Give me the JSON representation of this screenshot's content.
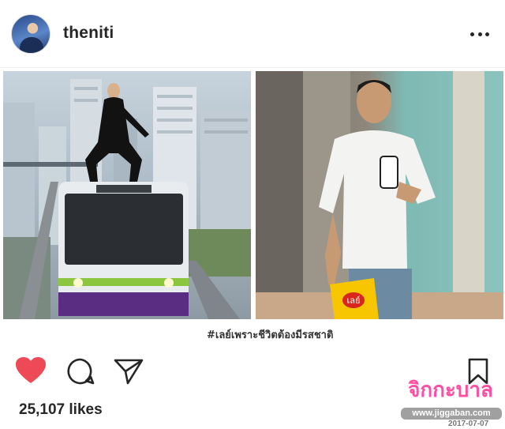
{
  "header": {
    "username": "theniti",
    "more_icon": "more-horizontal-icon"
  },
  "post": {
    "hashtag": "#เลย์เพราะชีวิตต้องมีรสชาติ",
    "left_photo": "woman-on-skytrain-photo",
    "right_photo": "man-with-chips-photo",
    "chips_brand": "เลย์"
  },
  "actions": {
    "like_icon": "heart-icon",
    "comment_icon": "comment-icon",
    "share_icon": "send-icon",
    "save_icon": "bookmark-icon",
    "like_color": "#ed4956"
  },
  "likes": {
    "text": "25,107 likes"
  },
  "watermark": {
    "logo": "จิกกะบาล",
    "url": "www.jiggaban.com",
    "date": "2017-07-07"
  }
}
